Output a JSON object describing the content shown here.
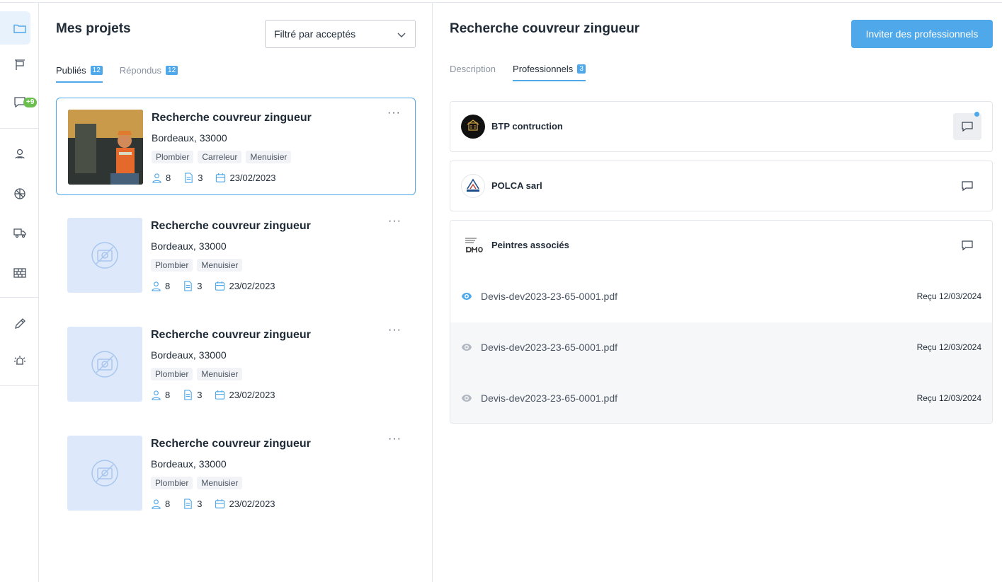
{
  "sidebar": {
    "messages_badge": "+9",
    "icons": [
      "folder-icon",
      "flag-icon",
      "chat-icon",
      "user-pin-icon",
      "helmet-icon",
      "truck-icon",
      "bricks-icon",
      "pencil-icon",
      "alarm-icon"
    ]
  },
  "left": {
    "title": "Mes projets",
    "filter": {
      "value": "Filtré par acceptés"
    },
    "tabs": [
      {
        "label": "Publiés",
        "count": "12"
      },
      {
        "label": "Répondus",
        "count": "12"
      }
    ],
    "projects": [
      {
        "title": "Recherche couvreur zingueur",
        "location": "Bordeaux, 33000",
        "tags": [
          "Plombier",
          "Carreleur",
          "Menuisier"
        ],
        "people": "8",
        "docs": "3",
        "date": "23/02/2023",
        "more": "···"
      },
      {
        "title": "Recherche couvreur zingueur",
        "location": "Bordeaux, 33000",
        "tags": [
          "Plombier",
          "Menuisier"
        ],
        "people": "8",
        "docs": "3",
        "date": "23/02/2023",
        "more": "···"
      },
      {
        "title": "Recherche couvreur zingueur",
        "location": "Bordeaux, 33000",
        "tags": [
          "Plombier",
          "Menuisier"
        ],
        "people": "8",
        "docs": "3",
        "date": "23/02/2023",
        "more": "···"
      },
      {
        "title": "Recherche couvreur zingueur",
        "location": "Bordeaux, 33000",
        "tags": [
          "Plombier",
          "Menuisier"
        ],
        "people": "8",
        "docs": "3",
        "date": "23/02/2023",
        "more": "···"
      }
    ]
  },
  "right": {
    "title": "Recherche couvreur zingueur",
    "invite_label": "Inviter des professionnels",
    "tabs": [
      {
        "label": "Description"
      },
      {
        "label": "Professionnels",
        "count": "3"
      }
    ],
    "professionals": [
      {
        "name": "BTP contruction"
      },
      {
        "name": "POLCA sarl"
      },
      {
        "name": "Peintres associés"
      }
    ],
    "files": [
      {
        "name": "Devis-dev2023-23-65-0001.pdf",
        "received": "Reçu 12/03/2024"
      },
      {
        "name": "Devis-dev2023-23-65-0001.pdf",
        "received": "Reçu 12/03/2024"
      },
      {
        "name": "Devis-dev2023-23-65-0001.pdf",
        "received": "Reçu 12/03/2024"
      }
    ]
  },
  "colors": {
    "accent": "#4fa8ea",
    "badge_green": "#6bbf4e",
    "placeholder_bg": "#dde9fb"
  }
}
